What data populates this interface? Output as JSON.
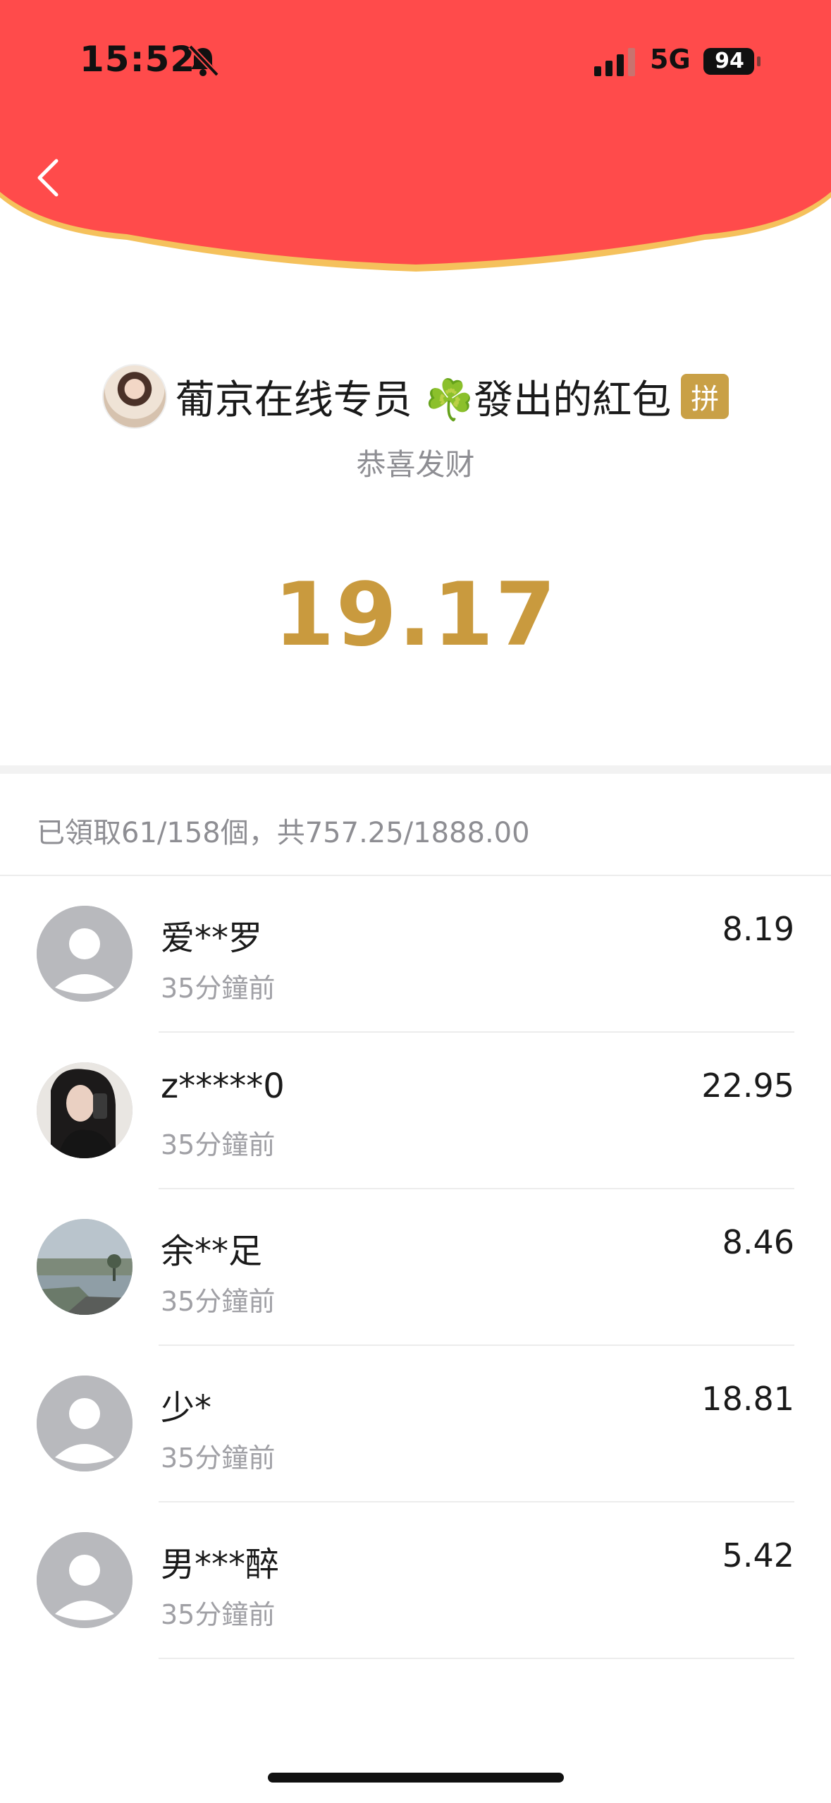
{
  "status_bar": {
    "time": "15:52",
    "network": "5G",
    "battery": "94"
  },
  "header": {
    "back_icon": "chevron-left-icon",
    "bg_color": "#ff4b4b",
    "edge_color": "#f5c15c"
  },
  "sender": {
    "name": "葡京在线专员",
    "clover": "☘️",
    "suffix": "發出的紅包",
    "badge": "拼",
    "wish": "恭喜发财"
  },
  "amount": "19.17",
  "summary": "已領取61/158個，共757.25/1888.00",
  "receivers": [
    {
      "name": "爱**罗",
      "time": "35分鐘前",
      "amount": "8.19",
      "avatar": "default-avatar"
    },
    {
      "name": "z*****0",
      "time": "35分鐘前",
      "amount": "22.95",
      "avatar": "photo-avatar-girl"
    },
    {
      "name": "余**足",
      "time": "35分鐘前",
      "amount": "8.46",
      "avatar": "photo-avatar-lake"
    },
    {
      "name": "少*",
      "time": "35分鐘前",
      "amount": "18.81",
      "avatar": "default-avatar"
    },
    {
      "name": "男***醉",
      "time": "35分鐘前",
      "amount": "5.42",
      "avatar": "default-avatar"
    }
  ]
}
